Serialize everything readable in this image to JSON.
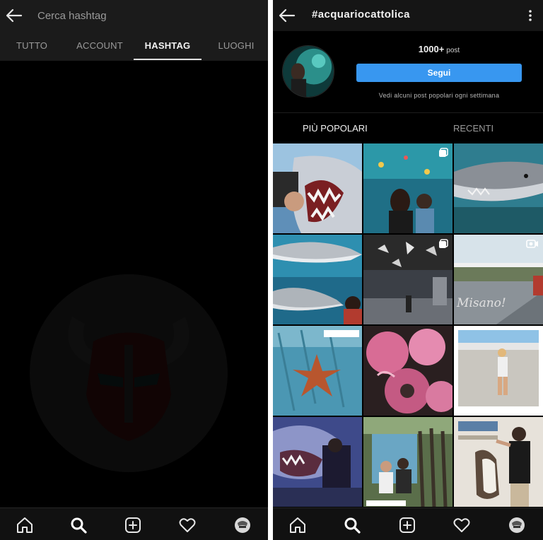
{
  "search_screen": {
    "placeholder": "Cerca hashtag",
    "tabs": [
      {
        "label": "TUTTO",
        "active": false
      },
      {
        "label": "ACCOUNT",
        "active": false
      },
      {
        "label": "HASHTAG",
        "active": true
      },
      {
        "label": "LUOGHI",
        "active": false
      }
    ]
  },
  "hashtag_screen": {
    "title": "#acquariocattolica",
    "post_count": "1000+",
    "post_label": "post",
    "follow_label": "Segui",
    "follow_note": "Vedi alcuni post popolari ogni settimana",
    "tabs": [
      {
        "label": "PIÙ POPOLARI",
        "active": true
      },
      {
        "label": "RECENTI",
        "active": false
      }
    ],
    "grid_tiles": [
      {
        "subject": "shark jaws model",
        "badge": null,
        "caption": null
      },
      {
        "subject": "child at aquarium tank",
        "badge": "multi-photo",
        "caption": null
      },
      {
        "subject": "sand tiger shark",
        "badge": null,
        "caption": null
      },
      {
        "subject": "sharks in tank",
        "badge": null,
        "caption": null
      },
      {
        "subject": "aquarium hall ceiling",
        "badge": "multi-photo",
        "caption": null
      },
      {
        "subject": "runway sign",
        "badge": "video",
        "caption": "Misano!"
      },
      {
        "subject": "starfish",
        "badge": null,
        "caption": null
      },
      {
        "subject": "sea anemones",
        "badge": null,
        "caption": null
      },
      {
        "subject": "girl on promenade",
        "badge": null,
        "caption": null
      },
      {
        "subject": "shark mural",
        "badge": null,
        "caption": null
      },
      {
        "subject": "family photo",
        "badge": null,
        "caption": null
      },
      {
        "subject": "man with penguin sign",
        "badge": null,
        "caption": null
      }
    ]
  },
  "bottom_nav": [
    "home-icon",
    "search-icon",
    "add-post-icon",
    "heart-icon",
    "profile-avatar"
  ],
  "colors": {
    "background": "#000000",
    "header": "#1b1b1b",
    "accent_blue": "#3897f0",
    "text_primary": "#f0f0f0",
    "text_secondary": "#9a9a9a"
  }
}
